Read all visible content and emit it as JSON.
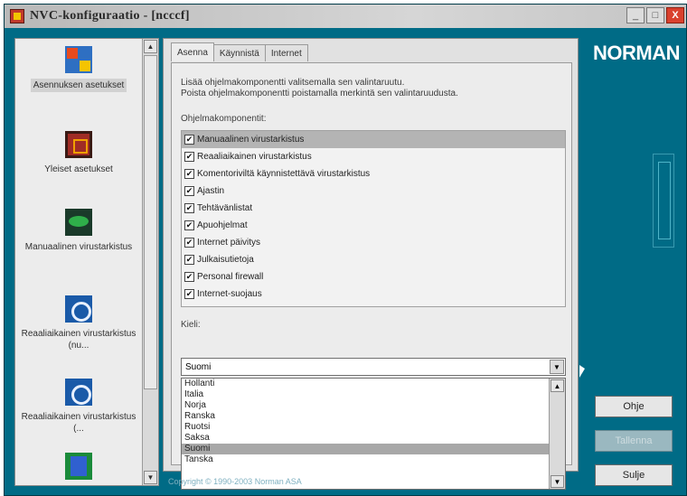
{
  "window": {
    "title": "NVC-konfiguraatio - [ncccf]",
    "buttons": {
      "minimize": "_",
      "maximize": "□",
      "close": "X"
    }
  },
  "sidebar": {
    "items": [
      {
        "label": "Asennuksen asetukset",
        "icon": "advanced-settings-icon",
        "selected": true
      },
      {
        "label": "Yleiset asetukset",
        "icon": "general-settings-icon",
        "selected": false
      },
      {
        "label": "Manuaalinen virustarkistus",
        "icon": "manual-scan-icon",
        "selected": false
      },
      {
        "label": "Reaaliaikainen virustarkistus (nu...",
        "icon": "realtime-scan-icon",
        "selected": false
      },
      {
        "label": "Reaaliaikainen virustarkistus (...",
        "icon": "realtime-scan-icon",
        "selected": false
      },
      {
        "label": "",
        "icon": "network-icon",
        "selected": false
      }
    ],
    "scroll_up": "▲",
    "scroll_down": "▼"
  },
  "tabs": [
    {
      "label": "Asenna",
      "active": true
    },
    {
      "label": "Käynnistä",
      "active": false
    },
    {
      "label": "Internet",
      "active": false
    }
  ],
  "instructions": [
    "Lisää ohjelmakomponentti valitsemalla sen valintaruutu.",
    "Poista ohjelmakomponentti poistamalla merkintä sen valintaruudusta."
  ],
  "components_label": "Ohjelmakomponentit:",
  "components": [
    {
      "label": "Manuaalinen virustarkistus",
      "checked": true,
      "selected": true
    },
    {
      "label": "Reaaliaikainen virustarkistus",
      "checked": true,
      "selected": false
    },
    {
      "label": "Komentoriviltä käynnistettävä virustarkistus",
      "checked": true,
      "selected": false
    },
    {
      "label": "Ajastin",
      "checked": true,
      "selected": false
    },
    {
      "label": "Tehtävänlistat",
      "checked": true,
      "selected": false
    },
    {
      "label": "Apuohjelmat",
      "checked": true,
      "selected": false
    },
    {
      "label": "Internet päivitys",
      "checked": true,
      "selected": false
    },
    {
      "label": "Julkaisutietoja",
      "checked": true,
      "selected": false
    },
    {
      "label": "Personal firewall",
      "checked": true,
      "selected": false
    },
    {
      "label": "Internet-suojaus",
      "checked": true,
      "selected": false
    }
  ],
  "language_label": "Kieli:",
  "language_selected": "Suomi",
  "language_options": [
    "Hollanti",
    "Italia",
    "Norja",
    "Ranska",
    "Ruotsi",
    "Saksa",
    "Suomi",
    "Tanska"
  ],
  "copyright": "Copyright © 1990-2003 Norman ASA",
  "brand": "NORMAN",
  "buttons": {
    "ok": "Ohje",
    "apply": "Tallenna",
    "close": "Sulje"
  }
}
